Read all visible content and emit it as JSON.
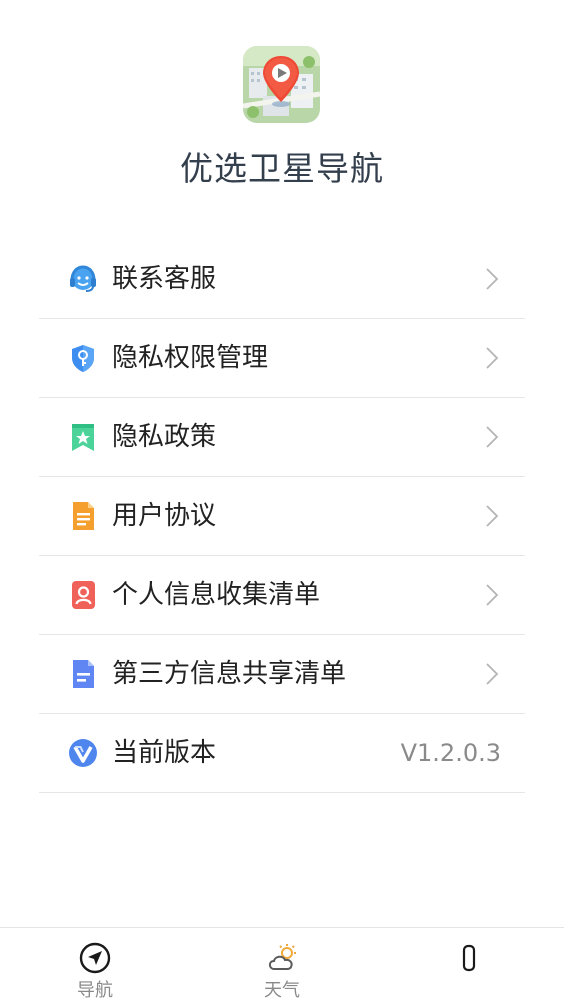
{
  "app": {
    "title": "优选卫星导航",
    "logo_icon": "map-pin-icon"
  },
  "menu": [
    {
      "label": "联系客服",
      "icon": "headset-icon",
      "color": "#4aa3f0"
    },
    {
      "label": "隐私权限管理",
      "icon": "shield-key-icon",
      "color": "#3d8ef0"
    },
    {
      "label": "隐私政策",
      "icon": "bookmark-star-icon",
      "color": "#4bd39a"
    },
    {
      "label": "用户协议",
      "icon": "document-icon",
      "color": "#f5a02e"
    },
    {
      "label": "个人信息收集清单",
      "icon": "person-card-icon",
      "color": "#f0615a"
    },
    {
      "label": "第三方信息共享清单",
      "icon": "file-lines-icon",
      "color": "#5f86f2"
    },
    {
      "label": "当前版本",
      "icon": "version-v-icon",
      "color": "#4f86ee",
      "value": "V1.2.0.3"
    }
  ],
  "tabs": [
    {
      "label": "导航",
      "icon": "compass-arrow-icon"
    },
    {
      "label": "天气",
      "icon": "cloud-sun-icon"
    },
    {
      "label": "",
      "icon": "phone-outline-icon"
    }
  ]
}
